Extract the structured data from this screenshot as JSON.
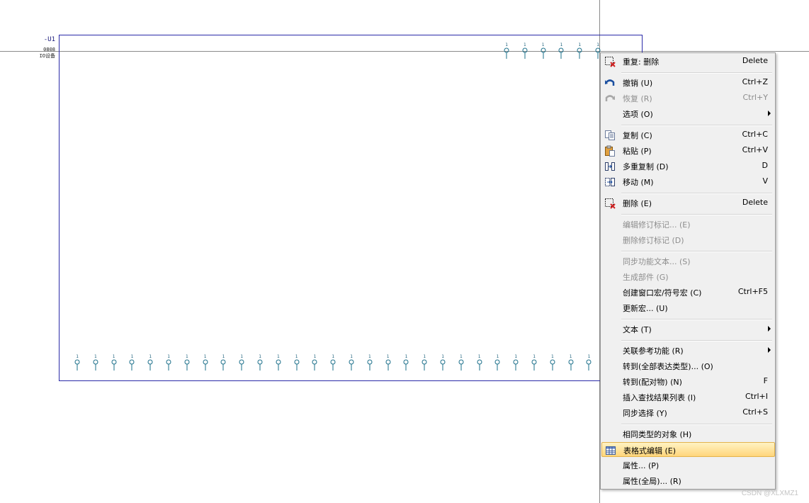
{
  "device": {
    "name": "-U1",
    "code": "0808",
    "desc": "IO设备",
    "pin_label": "1",
    "top_pin_count": 6,
    "bottom_pin_count": 29
  },
  "menu": {
    "items": [
      {
        "label": "重复: 删除",
        "shortcut": "Delete",
        "icon": "delete-icon",
        "disabled": false
      },
      {
        "label": "撤销 (U)",
        "shortcut": "Ctrl+Z",
        "icon": "undo-icon",
        "disabled": false
      },
      {
        "label": "恢复 (R)",
        "shortcut": "Ctrl+Y",
        "icon": "redo-icon",
        "disabled": true
      },
      {
        "label": "选项 (O)",
        "shortcut": "",
        "icon": "",
        "submenu": true
      },
      {
        "label": "复制 (C)",
        "shortcut": "Ctrl+C",
        "icon": "copy-icon"
      },
      {
        "label": "粘贴 (P)",
        "shortcut": "Ctrl+V",
        "icon": "paste-icon"
      },
      {
        "label": "多重复制 (D)",
        "shortcut": "D",
        "icon": "multi-copy-icon"
      },
      {
        "label": "移动 (M)",
        "shortcut": "V",
        "icon": "move-icon"
      },
      {
        "label": "删除 (E)",
        "shortcut": "Delete",
        "icon": "delete-icon"
      },
      {
        "label": "编辑修订标记... (E)",
        "shortcut": "",
        "disabled": true
      },
      {
        "label": "删除修订标记 (D)",
        "shortcut": "",
        "disabled": true
      },
      {
        "label": "同步功能文本... (S)",
        "shortcut": "",
        "disabled": true
      },
      {
        "label": "生成部件 (G)",
        "shortcut": "",
        "disabled": true
      },
      {
        "label": "创建窗口宏/符号宏 (C)",
        "shortcut": "Ctrl+F5"
      },
      {
        "label": "更新宏... (U)",
        "shortcut": ""
      },
      {
        "label": "文本 (T)",
        "shortcut": "",
        "submenu": true
      },
      {
        "label": "关联参考功能 (R)",
        "shortcut": "",
        "submenu": true
      },
      {
        "label": "转到(全部表达类型)... (O)",
        "shortcut": ""
      },
      {
        "label": "转到(配对物) (N)",
        "shortcut": "F"
      },
      {
        "label": "插入查找结果列表 (I)",
        "shortcut": "Ctrl+I"
      },
      {
        "label": "同步选择 (Y)",
        "shortcut": "Ctrl+S"
      },
      {
        "label": "相同类型的对象 (H)",
        "shortcut": ""
      },
      {
        "label": "表格式编辑 (E)",
        "shortcut": "",
        "icon": "table-icon",
        "highlighted": true
      },
      {
        "label": "属性... (P)",
        "shortcut": ""
      },
      {
        "label": "属性(全局)... (R)",
        "shortcut": ""
      }
    ]
  },
  "watermark": "CSDN @XLXMZ1",
  "colors": {
    "device_border": "#2a2aa8",
    "pin": "#1a6f8a",
    "highlight": "#ffd57a",
    "menu_bg": "#f0f0f0"
  }
}
